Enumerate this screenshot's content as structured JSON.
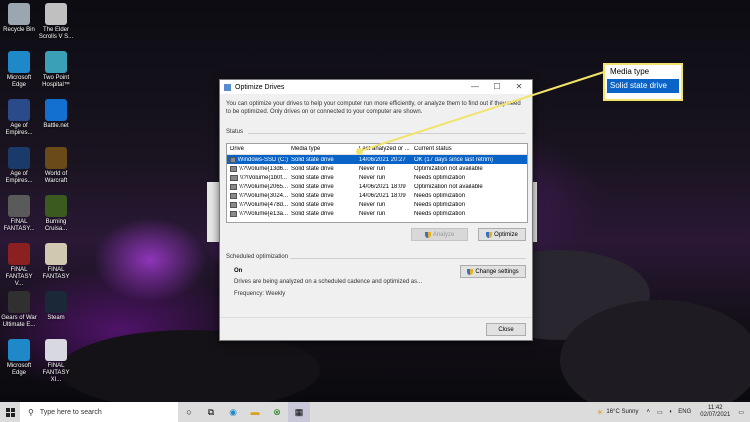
{
  "desktop_icons": [
    {
      "label": "Recycle Bin",
      "icon": "recycle-bin-icon",
      "color": "#9aa6b0"
    },
    {
      "label": "Microsoft Edge",
      "icon": "edge-icon",
      "color": "#1e88c8"
    },
    {
      "label": "Age of Empires...",
      "icon": "age-of-empires-icon",
      "color": "#2a4a8a"
    },
    {
      "label": "Age of Empires...",
      "icon": "age-of-empires-icon",
      "color": "#1a3a6a"
    },
    {
      "label": "FINAL FANTASY...",
      "icon": "final-fantasy-icon",
      "color": "#5a5a5a"
    },
    {
      "label": "FINAL FANTASY V...",
      "icon": "final-fantasy-icon",
      "color": "#8a2020"
    },
    {
      "label": "Gears of War Ultimate E...",
      "icon": "gears-of-war-icon",
      "color": "#303030"
    },
    {
      "label": "Microsoft Edge",
      "icon": "edge-icon",
      "color": "#1e88c8"
    },
    {
      "label": "The Elder Scrolls V S...",
      "icon": "elder-scrolls-icon",
      "color": "#c0c0c0"
    },
    {
      "label": "Two Point Hospital™",
      "icon": "two-point-hospital-icon",
      "color": "#3aa0b8"
    },
    {
      "label": "Battle.net",
      "icon": "battlenet-icon",
      "color": "#1470d0"
    },
    {
      "label": "World of Warcraft",
      "icon": "world-of-warcraft-icon",
      "color": "#6a4a18"
    },
    {
      "label": "Burning Cruisa...",
      "icon": "burning-crusade-icon",
      "color": "#3a5a20"
    },
    {
      "label": "FINAL FANTASY",
      "icon": "final-fantasy-icon",
      "color": "#d0c8b0"
    },
    {
      "label": "Steam",
      "icon": "steam-icon",
      "color": "#1b2838"
    },
    {
      "label": "FINAL FANTASY XI...",
      "icon": "final-fantasy-icon",
      "color": "#d8d8e0"
    }
  ],
  "dialog": {
    "title": "Optimize Drives",
    "minimize": "—",
    "maximize": "☐",
    "close": "✕",
    "description": "You can optimize your drives to help your computer run more efficiently, or analyze them to find out if they need to be optimized. Only drives on or connected to your computer are shown.",
    "status_label": "Status",
    "columns": [
      "Drive",
      "Media type",
      "Last analyzed or ...",
      "Current status"
    ],
    "rows": [
      {
        "drive": "Windows-SSD (C:)",
        "media": "Solid state drive",
        "last": "14/06/2021 20:27",
        "status": "OK (17 days since last retrim)",
        "selected": true
      },
      {
        "drive": "\\\\?\\Volume{13d6...",
        "media": "Solid state drive",
        "last": "Never run",
        "status": "Optimization not available",
        "selected": false
      },
      {
        "drive": "\\\\?\\Volume{1b0f...",
        "media": "Solid state drive",
        "last": "Never run",
        "status": "Needs optimization",
        "selected": false
      },
      {
        "drive": "\\\\?\\Volume{2065...",
        "media": "Solid state drive",
        "last": "14/06/2021 18:09",
        "status": "Optimization not available",
        "selected": false
      },
      {
        "drive": "\\\\?\\Volume{3024...",
        "media": "Solid state drive",
        "last": "14/06/2021 18:09",
        "status": "Needs optimization",
        "selected": false
      },
      {
        "drive": "\\\\?\\Volume{478d...",
        "media": "Solid state drive",
        "last": "Never run",
        "status": "Needs optimization",
        "selected": false
      },
      {
        "drive": "\\\\?\\Volume{e13a...",
        "media": "Solid state drive",
        "last": "Never run",
        "status": "Needs optimization",
        "selected": false
      }
    ],
    "analyze_label": "Analyze",
    "optimize_label": "Optimize",
    "scheduled_label": "Scheduled optimization",
    "scheduled_state": "On",
    "scheduled_desc": "Drives are being analyzed on a scheduled cadence and optimized as...",
    "frequency": "Frequency: Weekly",
    "change_settings_label": "Change settings",
    "close_label": "Close"
  },
  "callout": {
    "header": "Media type",
    "value": "Solid state drive",
    "border_color": "#f2e36b"
  },
  "taskbar": {
    "search_placeholder": "Type here to search",
    "weather": "16°C  Sunny",
    "language": "ENG",
    "time": "11:42",
    "date": "02/07/2021"
  }
}
